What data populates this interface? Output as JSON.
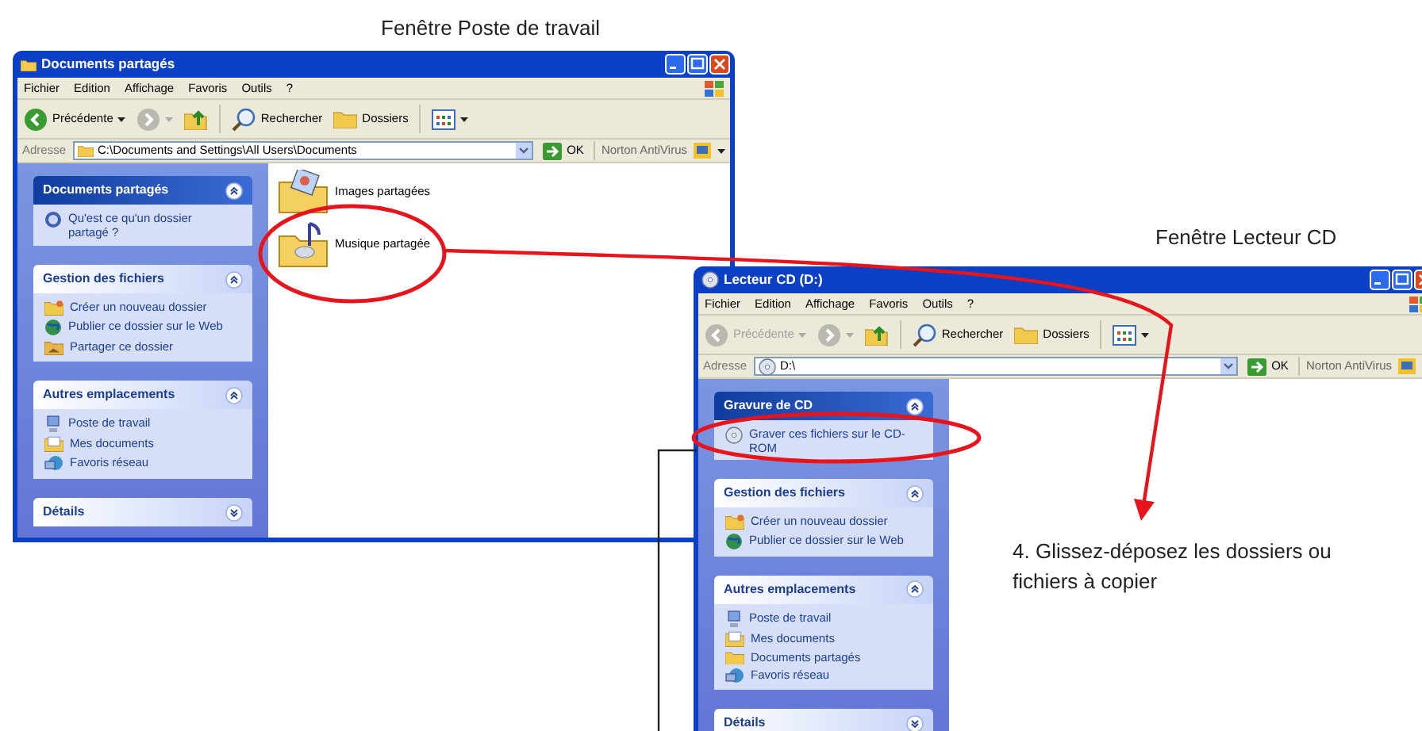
{
  "windows": [
    {
      "caption": "Fenêtre Poste de travail",
      "title": "Documents partagés",
      "menu": [
        "Fichier",
        "Edition",
        "Affichage",
        "Favoris",
        "Outils",
        "?"
      ],
      "back_label": "Précédente",
      "back_enabled": true,
      "search_label": "Rechercher",
      "folders_label": "Dossiers",
      "address_label": "Adresse",
      "address": "C:\\Documents and Settings\\All Users\\Documents",
      "go_label": "OK",
      "norton_label": "Norton AntiVirus",
      "tasks": [
        {
          "kind": "special",
          "title": "Documents partagés",
          "expanded": true,
          "items": [
            {
              "kind": "help",
              "label": "Qu'est ce qu'un dossier partagé ?"
            }
          ]
        },
        {
          "kind": "normal",
          "title": "Gestion des fichiers",
          "expanded": true,
          "items": [
            {
              "kind": "newfolder",
              "label": "Créer un nouveau dossier"
            },
            {
              "kind": "globe",
              "label": "Publier ce dossier sur le Web"
            },
            {
              "kind": "share",
              "label": "Partager ce dossier"
            }
          ]
        },
        {
          "kind": "normal",
          "title": "Autres emplacements",
          "expanded": true,
          "items": [
            {
              "kind": "computer",
              "label": "Poste de travail"
            },
            {
              "kind": "docs",
              "label": "Mes documents"
            },
            {
              "kind": "network",
              "label": "Favoris réseau"
            }
          ]
        },
        {
          "kind": "normal",
          "title": "Détails",
          "expanded": false
        }
      ],
      "files": [
        {
          "kind": "images",
          "label": "Images partagées"
        },
        {
          "kind": "music",
          "label": "Musique partagée"
        }
      ]
    },
    {
      "caption": "Fenêtre Lecteur CD",
      "title": "Lecteur CD (D:)",
      "menu": [
        "Fichier",
        "Edition",
        "Affichage",
        "Favoris",
        "Outils",
        "?"
      ],
      "back_label": "Précédente",
      "back_enabled": false,
      "search_label": "Rechercher",
      "folders_label": "Dossiers",
      "address_label": "Adresse",
      "address": "D:\\",
      "go_label": "OK",
      "norton_label": "Norton AntiVirus",
      "tasks": [
        {
          "kind": "special",
          "title": "Gravure de CD",
          "expanded": true,
          "items": [
            {
              "kind": "burn",
              "label": "Graver ces fichiers sur le CD-ROM"
            }
          ]
        },
        {
          "kind": "normal",
          "title": "Gestion des fichiers",
          "expanded": true,
          "items": [
            {
              "kind": "newfolder",
              "label": "Créer un nouveau dossier"
            },
            {
              "kind": "globe",
              "label": "Publier ce dossier sur le Web"
            }
          ]
        },
        {
          "kind": "normal",
          "title": "Autres emplacements",
          "expanded": true,
          "items": [
            {
              "kind": "computer",
              "label": "Poste de travail"
            },
            {
              "kind": "docs",
              "label": "Mes documents"
            },
            {
              "kind": "folder",
              "label": "Documents partagés"
            },
            {
              "kind": "network",
              "label": "Favoris réseau"
            }
          ]
        },
        {
          "kind": "normal",
          "title": "Détails",
          "expanded": false
        }
      ]
    }
  ],
  "instruction": "4. Glissez-déposez les dossiers ou fichiers à copier"
}
